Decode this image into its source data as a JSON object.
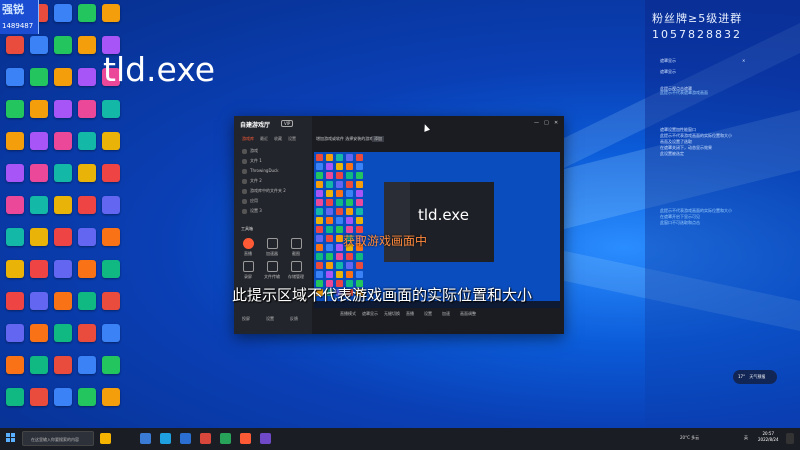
{
  "stream": {
    "badge_logo": "强锐",
    "badge_number": "1489487",
    "fan_badge": "粉丝牌≥5级进群",
    "qq_group": "1057828832"
  },
  "right_panel": {
    "lines_top": [
      "遮罩显示",
      "遮罩显示"
    ],
    "lines_mid": [
      "此提示视点击遮罩",
      "此提示视点击遮罩"
    ],
    "lines_blue1": [
      "此提示不代表遮罩游戏画面"
    ],
    "lines_body": [
      "遮罩设置加性能窗口",
      "此提示不代表游戏画面的实际位置和大小",
      "画面及设置了选取",
      "在遮罩关闭下，动态显示效果",
      "此设置被选定"
    ],
    "lines_blue2": [
      "此提示不代表游戏画面的实际位置和大小",
      "在遮罩开启下显示可见",
      "此窗口不可选取和点击"
    ]
  },
  "app": {
    "brand": "自建游戏厅",
    "brand_tag": "VIP",
    "side_tabs": [
      "游戏库",
      "最近",
      "收藏",
      "设置"
    ],
    "game_items": [
      "游戏",
      "文件 1",
      "ThrowingDuck",
      "文件 2",
      "游戏库中的文件夹 2",
      "应用",
      "设置 3",
      "最近"
    ],
    "tools_title": "工具箱",
    "tools": [
      "直播",
      "加速器",
      "截图",
      "录屏",
      "文件传输",
      "存储管理"
    ],
    "side_bottom": [
      "投屏",
      "设置",
      "反馈"
    ],
    "main_title": "增加游戏或软件 选择安装的游戏",
    "main_title_tag": "添加",
    "window_controls": [
      "—",
      "□",
      "✕"
    ],
    "bottom_items": [
      "直播模式",
      "遮罩显示",
      "无缝切换",
      "直播",
      "设置",
      "加速",
      "画面调整"
    ],
    "process_name": "tld.exe",
    "process_name_small": "tld.exe",
    "capture_status": "获取游戏画面中"
  },
  "subtitle": "此提示区域不代表游戏画面的实际位置和大小",
  "taskbar": {
    "search_placeholder": "在这里输入你要搜索的内容",
    "weather": "20°C 多云",
    "ime": "英",
    "time": "20:57",
    "date": "2022/8/24"
  },
  "widget": {
    "value": "17°",
    "label": "天气预报"
  },
  "colors": {
    "accent": "#ff5a36",
    "desktop": "#0a4dbf",
    "taskbar": "#1a1d24"
  }
}
